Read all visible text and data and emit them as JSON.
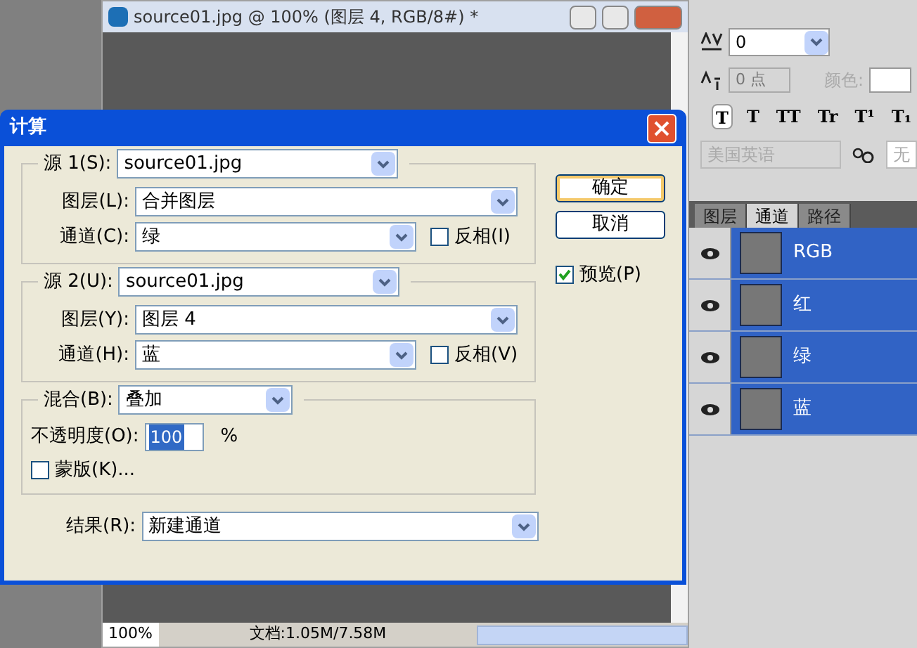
{
  "document_window": {
    "title": "source01.jpg @ 100% (图层 4, RGB/8#) *",
    "zoom": "100%",
    "status": "文档:1.05M/7.58M"
  },
  "character_panel": {
    "tracking": "0",
    "baseline": "0 点",
    "color_label": "颜色:",
    "styles": [
      {
        "label": "T",
        "selected": true
      },
      {
        "label": "T",
        "selected": false
      },
      {
        "label": "TT",
        "selected": false
      },
      {
        "label": "Tr",
        "selected": false
      },
      {
        "label": "T¹",
        "selected": false
      },
      {
        "label": "T₁",
        "selected": false
      }
    ],
    "language": "美国英语",
    "antialias": "无"
  },
  "channels_panel": {
    "tabs": [
      {
        "label": "图层",
        "selected": false
      },
      {
        "label": "通道",
        "selected": true
      },
      {
        "label": "路径",
        "selected": false
      }
    ],
    "channels": [
      {
        "name": "RGB",
        "visible": true,
        "selected": true
      },
      {
        "name": "红",
        "visible": true,
        "selected": true
      },
      {
        "name": "绿",
        "visible": true,
        "selected": true
      },
      {
        "name": "蓝",
        "visible": true,
        "selected": true
      }
    ]
  },
  "dialog": {
    "title": "计算",
    "sources": [
      {
        "label": "源 1(S):",
        "file": "source01.jpg",
        "layer_label": "图层(L):",
        "layer": "合并图层",
        "channel_label": "通道(C):",
        "channel": "绿",
        "invert_label": "反相(I)",
        "invert": false
      },
      {
        "label": "源 2(U):",
        "file": "source01.jpg",
        "layer_label": "图层(Y):",
        "layer": "图层 4",
        "channel_label": "通道(H):",
        "channel": "蓝",
        "invert_label": "反相(V)",
        "invert": false
      }
    ],
    "blending": {
      "label": "混合(B):",
      "mode": "叠加",
      "opacity_label": "不透明度(O):",
      "opacity": "100",
      "opacity_unit": "%",
      "mask_label": "蒙版(K)...",
      "mask": false
    },
    "result": {
      "label": "结果(R):",
      "value": "新建通道"
    },
    "buttons": [
      {
        "label": "确定",
        "default": true
      },
      {
        "label": "取消",
        "default": false
      }
    ],
    "preview": {
      "label": "预览(P)",
      "checked": true
    }
  }
}
